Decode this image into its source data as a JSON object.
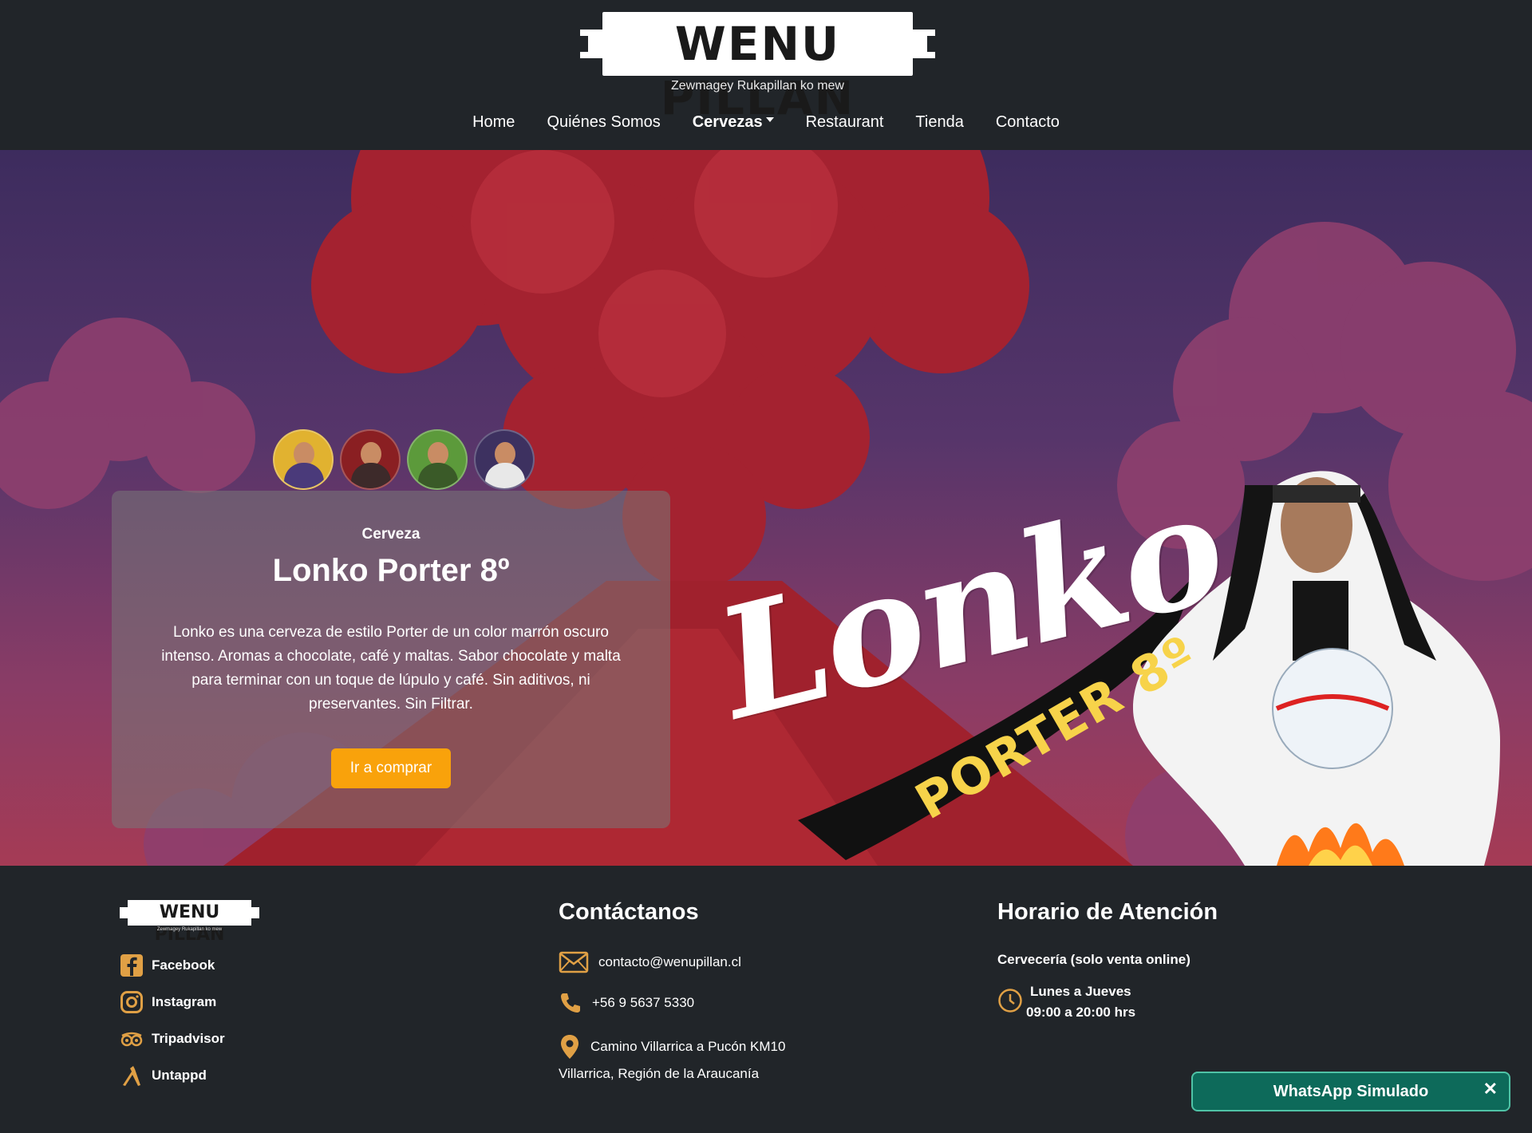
{
  "brand": {
    "name": "WENU PILLAN",
    "tagline": "Zewmagey Rukapillan ko mew"
  },
  "nav": {
    "items": [
      {
        "label": "Home",
        "active": false
      },
      {
        "label": "Quiénes Somos",
        "active": false
      },
      {
        "label": "Cervezas",
        "active": true,
        "dropdown": true
      },
      {
        "label": "Restaurant",
        "active": false
      },
      {
        "label": "Tienda",
        "active": false
      },
      {
        "label": "Contacto",
        "active": false
      }
    ]
  },
  "hero": {
    "eyebrow": "Cerveza",
    "title": "Lonko Porter 8º",
    "description": "Lonko es una cerveza de estilo Porter de un color marrón oscuro intenso. Aromas a chocolate, café y maltas. Sabor chocolate y malta para terminar con un toque de lúpulo y café. Sin aditivos, ni preservantes. Sin Filtrar.",
    "buy_label": "Ir a comprar",
    "artwork_title": "Lonko",
    "artwork_subtitle": "PORTER 8º",
    "accent_color": "#f9a20b"
  },
  "footer": {
    "social": [
      {
        "label": "Facebook",
        "icon": "facebook-icon"
      },
      {
        "label": "Instagram",
        "icon": "instagram-icon"
      },
      {
        "label": "Tripadvisor",
        "icon": "tripadvisor-icon"
      },
      {
        "label": "Untappd",
        "icon": "untappd-icon"
      }
    ],
    "contact": {
      "title": "Contáctanos",
      "email": "contacto@wenupillan.cl",
      "phone": "+56 9 5637 5330",
      "address_line1": "Camino Villarrica a Pucón KM10",
      "address_line2": "Villarrica, Región de la Araucanía"
    },
    "hours": {
      "title": "Horario de Atención",
      "subtitle": "Cervecería (solo venta online)",
      "days": "Lunes a Jueves",
      "time": "09:00 a 20:00 hrs"
    },
    "icon_color": "#e0a045"
  },
  "whatsapp": {
    "label": "WhatsApp Simulado",
    "close": "✕"
  }
}
